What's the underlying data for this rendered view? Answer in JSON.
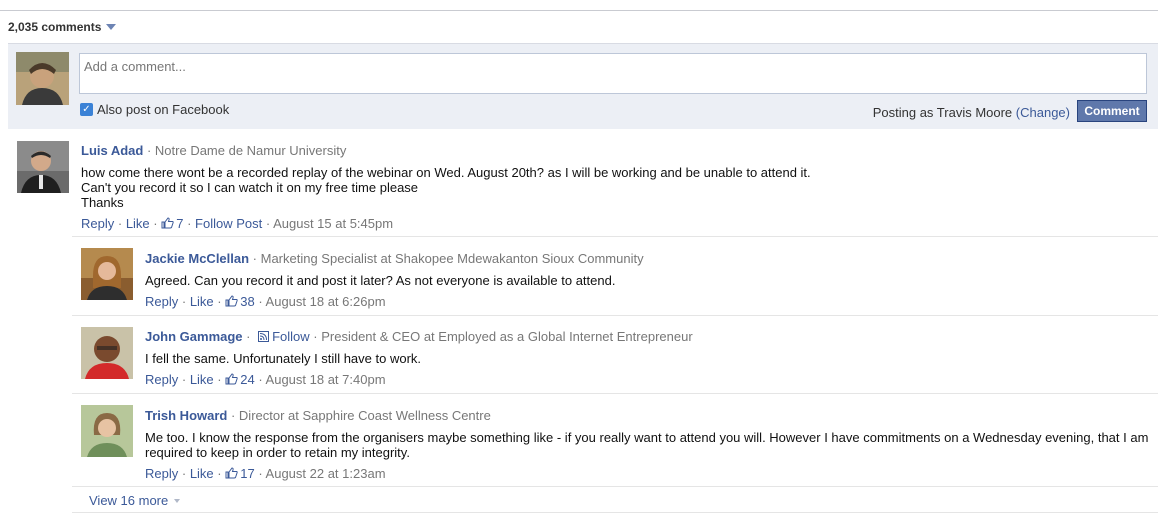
{
  "header": {
    "comment_count": "2,035 comments"
  },
  "compose": {
    "placeholder": "Add a comment...",
    "also_post_label": "Also post on Facebook",
    "also_post_checked": true,
    "posting_as_prefix": "Posting as Travis Moore",
    "change_link": "(Change)",
    "submit_label": "Comment"
  },
  "comments": [
    {
      "name": "Luis Adad",
      "meta": " · Notre Dame de Namur University",
      "lines": [
        "how come there wont be a recorded replay of the webinar on Wed. August 20th? as I will be working and be unable to attend it.",
        "Can't you record it so I can watch it on my free time please",
        "Thanks"
      ],
      "reply": "Reply",
      "like": "Like",
      "likes": "7",
      "follow_post": "Follow Post",
      "time": "August 15 at 5:45pm"
    }
  ],
  "replies": [
    {
      "name": "Jackie McClellan",
      "meta": " · Marketing Specialist at Shakopee Mdewakanton Sioux Community",
      "text": "Agreed. Can you record it and post it later? As not everyone is available to attend.",
      "reply": "Reply",
      "like": "Like",
      "likes": "38",
      "time": "August 18 at 6:26pm"
    },
    {
      "name": "John Gammage",
      "follow": "Follow",
      "meta": " · President & CEO at Employed as a Global Internet Entrepreneur",
      "text": "I fell the same. Unfortunately I still have to work.",
      "reply": "Reply",
      "like": "Like",
      "likes": "24",
      "time": "August 18 at 7:40pm"
    },
    {
      "name": "Trish Howard",
      "meta": " · Director at Sapphire Coast Wellness Centre",
      "lines": [
        "Me too. I know the response from the organisers maybe something like - if you really want to attend you will. However I have commitments on a Wednesday evening, that I am",
        "required to keep in order to retain my integrity."
      ],
      "reply": "Reply",
      "like": "Like",
      "likes": "17",
      "time": "August 22 at 1:23am"
    }
  ],
  "footer": {
    "view_more": "View 16 more"
  },
  "colors": {
    "link": "#3b5998",
    "button": "#5f78ab",
    "compose_bg": "#eceff5"
  }
}
